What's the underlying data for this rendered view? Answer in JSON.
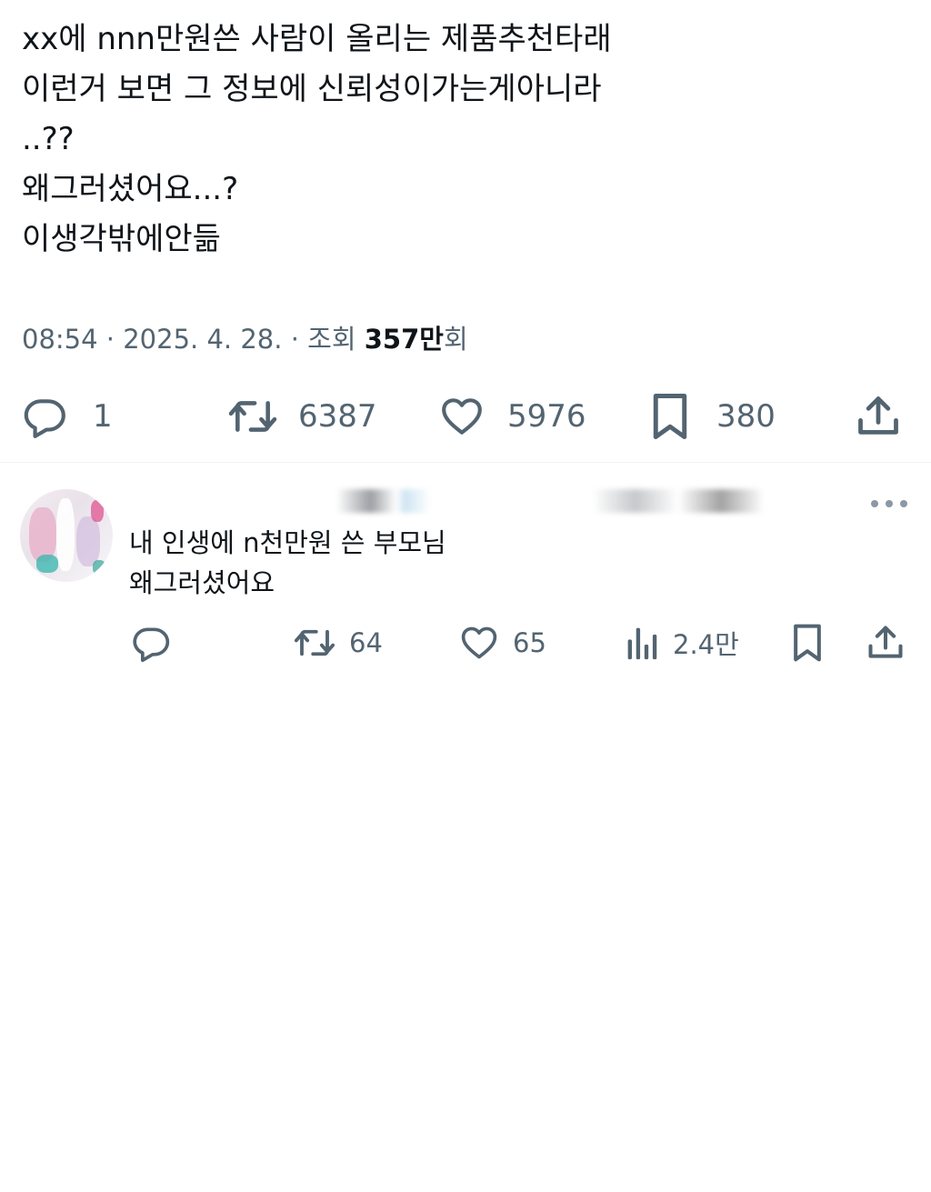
{
  "tweet": {
    "lines": [
      "xx에 nnn만원쓴 사람이 올리는 제품추천타래",
      "이런거 보면 그 정보에 신뢰성이가는게아니라",
      "..??",
      "왜그러셨어요...?",
      "이생각밖에안듦"
    ],
    "time": "08:54",
    "date": "2025. 4. 28.",
    "views_label": "조회",
    "views_value": "357만",
    "views_suffix": "회",
    "separator": "·",
    "actions": {
      "reply_count": "1",
      "retweet_count": "6387",
      "like_count": "5976",
      "bookmark_count": "380"
    }
  },
  "reply": {
    "lines": [
      "내 인생에 n천만원 쓴 부모님",
      "왜그러셨어요"
    ],
    "actions": {
      "retweet_count": "64",
      "like_count": "65",
      "views_count": "2.4만"
    }
  },
  "icons": {
    "reply": "comment-bubble-icon",
    "retweet": "retweet-icon",
    "like": "heart-icon",
    "bookmark": "bookmark-icon",
    "share": "share-upload-icon",
    "views": "bar-chart-icon",
    "more": "more-dots-icon"
  },
  "colors": {
    "text": "#0f1419",
    "secondary": "#536471",
    "divider": "#eff3f4"
  }
}
